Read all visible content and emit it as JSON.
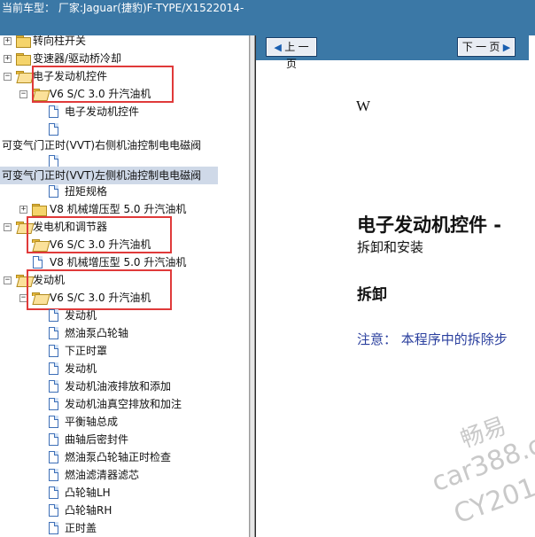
{
  "topbar": {
    "title": "当前车型：  厂家:Jaguar(捷豹)F-TYPE/X1522014-"
  },
  "tree": {
    "rows": [
      {
        "label": "转向柱开关"
      },
      {
        "label": "变速器/驱动桥冷却"
      },
      {
        "label": "电子发动机控件"
      },
      {
        "label": "V6 S/C 3.0 升汽油机"
      },
      {
        "label": "电子发动机控件"
      },
      {
        "label": ""
      },
      {
        "label": "可变气门正时(VVT)右侧机油控制电电磁阀"
      },
      {
        "label": ""
      },
      {
        "label": "可变气门正时(VVT)左侧机油控制电电磁阀"
      },
      {
        "label": "扭矩规格"
      },
      {
        "label": "V8 机械增压型 5.0 升汽油机"
      },
      {
        "label": "发电机和调节器"
      },
      {
        "label": "V6 S/C 3.0 升汽油机"
      },
      {
        "label": "V8 机械增压型 5.0 升汽油机"
      },
      {
        "label": "发动机"
      },
      {
        "label": "V6 S/C 3.0 升汽油机"
      },
      {
        "label": "发动机"
      },
      {
        "label": "燃油泵凸轮轴"
      },
      {
        "label": "下正时罩"
      },
      {
        "label": "发动机"
      },
      {
        "label": "发动机油液排放和添加"
      },
      {
        "label": "发动机油真空排放和加注"
      },
      {
        "label": "平衡轴总成"
      },
      {
        "label": "曲轴后密封件"
      },
      {
        "label": "燃油泵凸轮轴正时检查"
      },
      {
        "label": "燃油滤清器滤芯"
      },
      {
        "label": "凸轮轴LH"
      },
      {
        "label": "凸轮轴RH"
      },
      {
        "label": "正时盖"
      }
    ]
  },
  "viewer": {
    "prev_label": "上 一 页",
    "next_label": "下 一 页",
    "page_letter": "W",
    "heading": "电子发动机控件 -",
    "subheading": "拆卸和安装",
    "section": "拆卸",
    "note": "注意：   本程序中的拆除步"
  },
  "watermark": {
    "line1": "畅易",
    "line2": "car388.c",
    "line3": "CY201"
  },
  "colors": {
    "header_blue": "#3b78a6",
    "highlight_red": "#e03a3a",
    "note_blue": "#2a3f9e"
  }
}
